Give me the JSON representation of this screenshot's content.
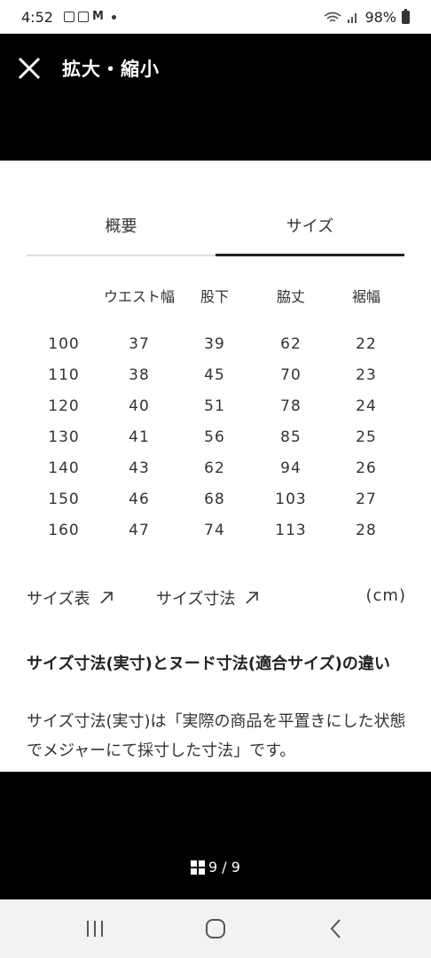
{
  "status_bar": {
    "time": "4:52",
    "battery": "98%"
  },
  "header": {
    "title": "拡大・縮小"
  },
  "tabs": [
    {
      "label": "概要",
      "active": false
    },
    {
      "label": "サイズ",
      "active": true
    }
  ],
  "size_table": {
    "headers": [
      "",
      "ウエスト幅",
      "股下",
      "脇丈",
      "裾幅"
    ],
    "rows": [
      [
        "100",
        "37",
        "39",
        "62",
        "22"
      ],
      [
        "110",
        "38",
        "45",
        "70",
        "23"
      ],
      [
        "120",
        "40",
        "51",
        "78",
        "24"
      ],
      [
        "130",
        "41",
        "56",
        "85",
        "25"
      ],
      [
        "140",
        "43",
        "62",
        "94",
        "26"
      ],
      [
        "150",
        "46",
        "68",
        "103",
        "27"
      ],
      [
        "160",
        "47",
        "74",
        "113",
        "28"
      ]
    ]
  },
  "links": {
    "size_chart": "サイズ表",
    "size_dimensions": "サイズ寸法",
    "unit": "(cm)"
  },
  "info": {
    "heading": "サイズ寸法(実寸)とヌード寸法(適合サイズ)の違い",
    "body": "サイズ寸法(実寸)は「実際の商品を平置きにした状態でメジャーにて採寸した寸法」です。"
  },
  "pager": {
    "counter": "9 / 9"
  },
  "colors": {
    "background": "#000000",
    "content": "#ffffff",
    "text": "#222222",
    "tab_active_underline": "#222222"
  }
}
